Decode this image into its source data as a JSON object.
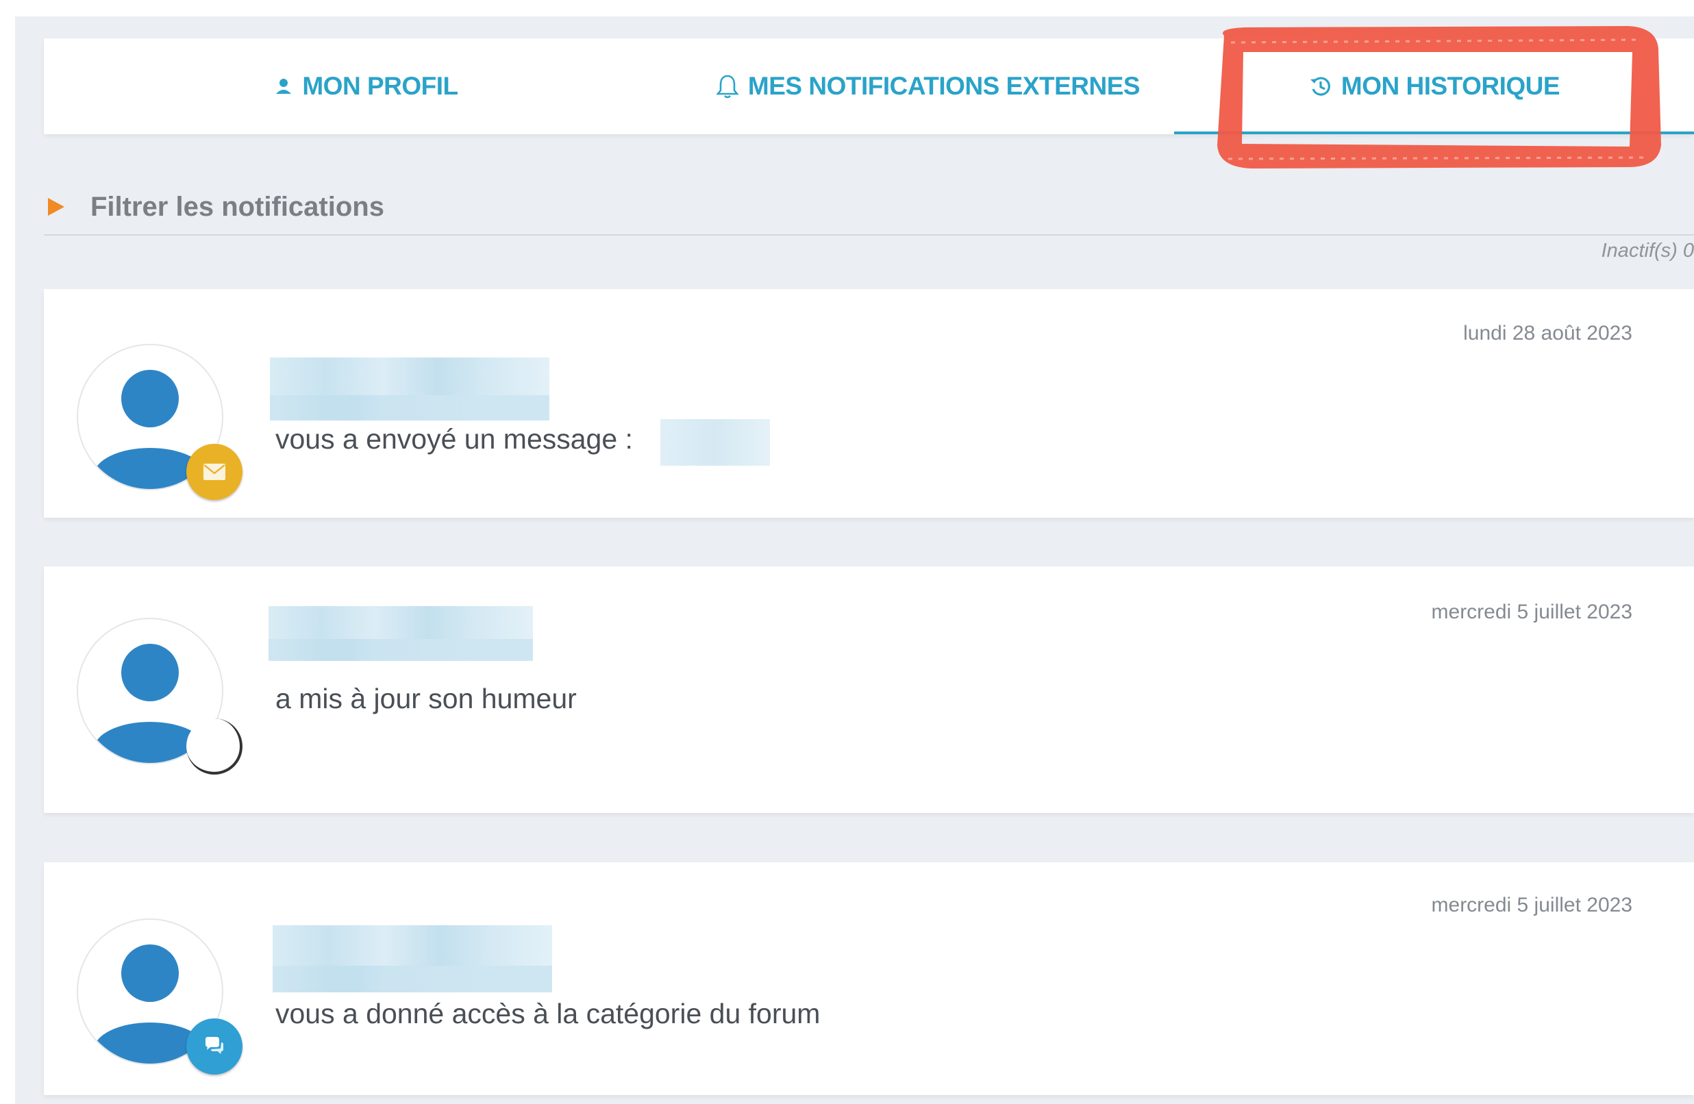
{
  "tabs": {
    "profile": {
      "label": "MON PROFIL",
      "icon": "user-icon"
    },
    "notifications": {
      "label": "MES NOTIFICATIONS EXTERNES",
      "icon": "bell-icon"
    },
    "history": {
      "label": "MON HISTORIQUE",
      "icon": "history-icon",
      "active": true
    }
  },
  "filter": {
    "label": "Filtrer les notifications",
    "inactive_count": "Inactif(s) 0"
  },
  "notifications": [
    {
      "message": "vous a envoyé un message :",
      "date": "lundi 28 août 2023",
      "badge_icon": "mail-icon"
    },
    {
      "message": "a mis à jour son humeur",
      "date": "mercredi 5 juillet 2023",
      "badge_icon": "mood-icon"
    },
    {
      "message": "vous a donné accès à la catégorie  du forum",
      "date": "mercredi 5 juillet 2023",
      "badge_icon": "forum-chat-icon"
    }
  ],
  "colors": {
    "accent": "#2aa3c9",
    "avatar": "#2e85c6",
    "filter_arrow": "#f08a24",
    "highlight": "#f05a47",
    "mail_badge": "#e9b125",
    "forum_badge": "#2f9fd4",
    "background": "#ebeef2"
  }
}
